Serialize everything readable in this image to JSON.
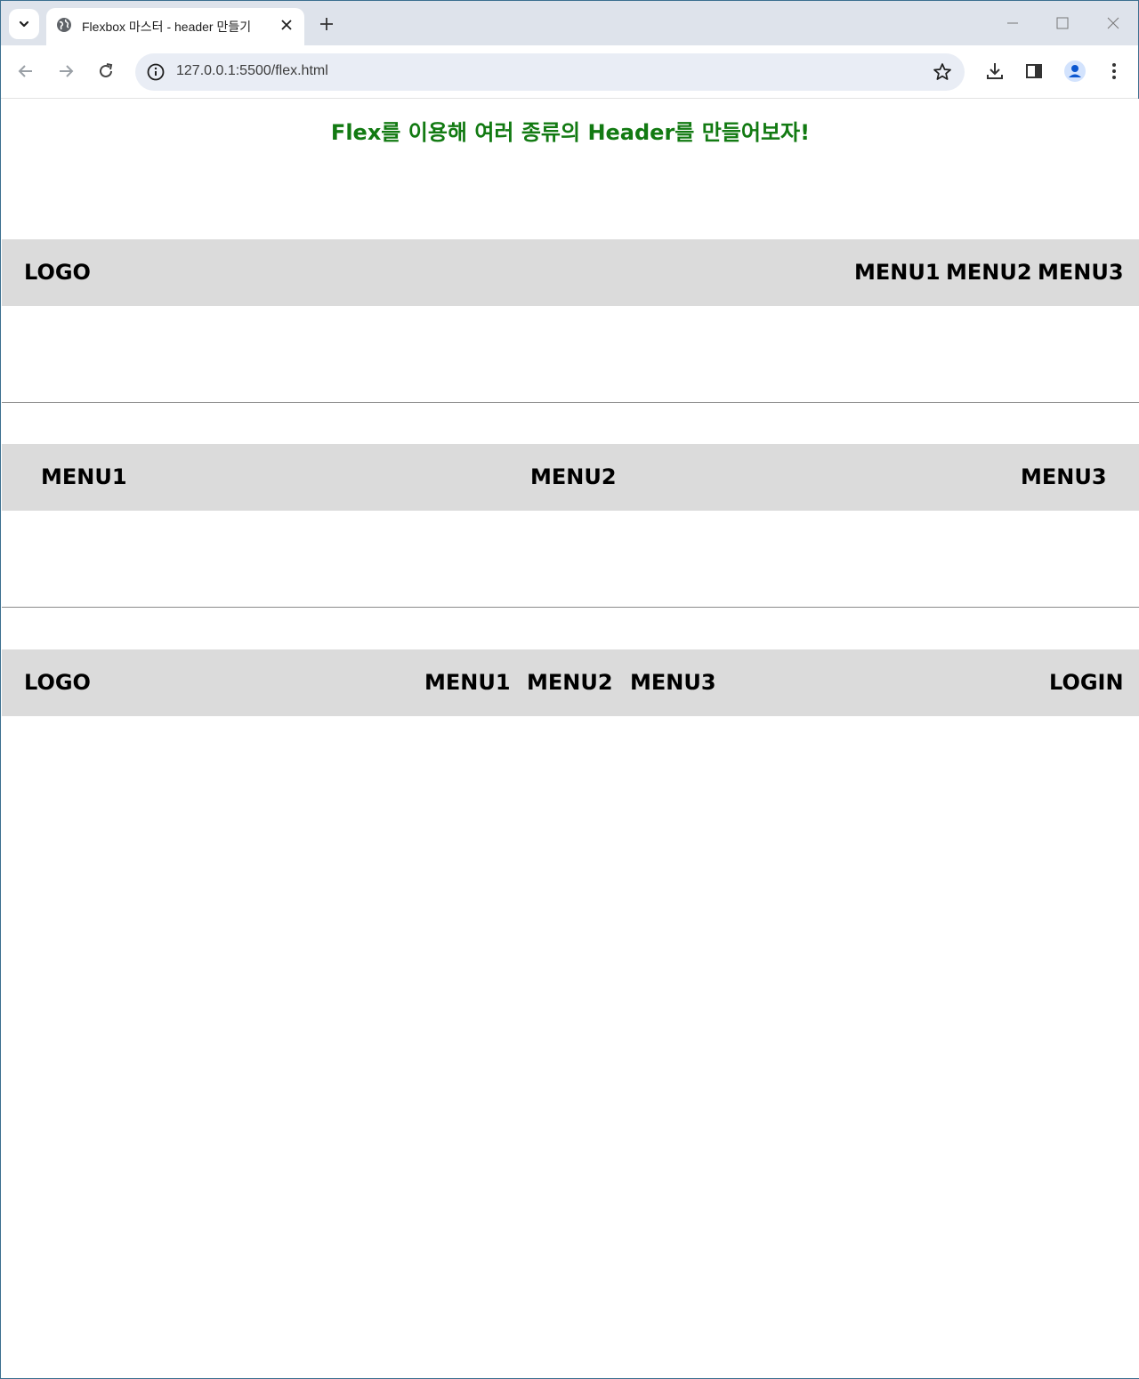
{
  "browser": {
    "tab_title": "Flexbox 마스터 - header 만들기",
    "url": "127.0.0.1:5500/flex.html"
  },
  "page": {
    "title": "Flex를 이용해 여러 종류의 Header를 만들어보자!",
    "title_color": "#127a12",
    "header_bg": "#dbdbdb",
    "header1": {
      "logo": "LOGO",
      "menu1": "MENU1",
      "menu2": "MENU2",
      "menu3": "MENU3"
    },
    "header2": {
      "menu1": "MENU1",
      "menu2": "MENU2",
      "menu3": "MENU3"
    },
    "header3": {
      "logo": "LOGO",
      "menu1": "MENU1",
      "menu2": "MENU2",
      "menu3": "MENU3",
      "login": "LOGIN"
    }
  }
}
